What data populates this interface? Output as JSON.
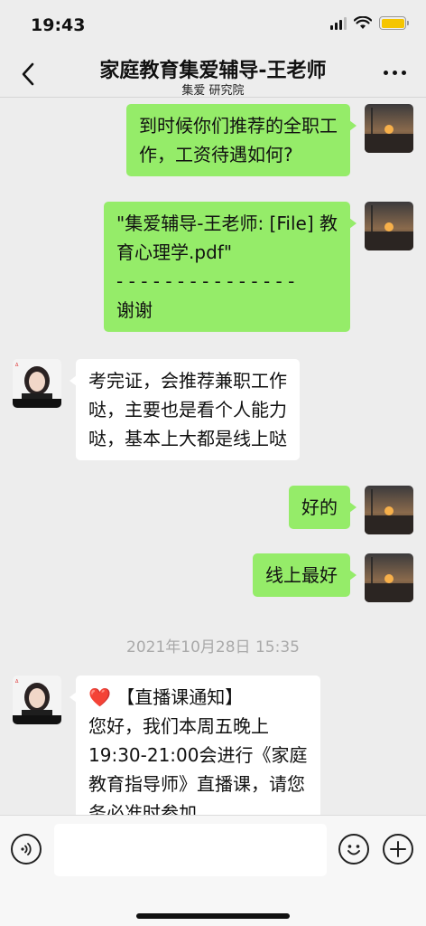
{
  "status_bar": {
    "time": "19:43",
    "battery_color": "#f5c500"
  },
  "nav": {
    "title": "家庭教育集爱辅导-王老师",
    "subtitle": "集爱 研究院",
    "back_icon": "chevron-left-icon",
    "more_icon": "more-dots-icon"
  },
  "messages": [
    {
      "sender": "me",
      "lines": [
        "到时候你们推荐的全职工",
        "作，工资待遇如何?"
      ]
    },
    {
      "sender": "me",
      "lines": [
        "\"集爱辅导-王老师: [File] 教",
        "育心理学.pdf\"",
        "- - - - - - - - - - - - - - -",
        "谢谢"
      ]
    },
    {
      "sender": "other",
      "lines": [
        "考完证，会推荐兼职工作",
        "哒，主要也是看个人能力",
        "哒，基本上大都是线上哒"
      ]
    },
    {
      "sender": "me",
      "lines": [
        "好的"
      ]
    },
    {
      "sender": "me",
      "lines": [
        "线上最好"
      ]
    },
    {
      "sender": "other",
      "lines": [
        "❤️ 【直播课通知】",
        "您好，我们本周五晚上",
        "19:30-21:00会进行《家庭",
        "教育指导师》直播课，请您",
        "务必准时参加"
      ]
    }
  ],
  "timestamp": "2021年10月28日 15:35",
  "input_bar": {
    "voice_icon": "voice-icon",
    "emoji_icon": "emoji-icon",
    "plus_icon": "plus-icon",
    "input_value": ""
  },
  "colors": {
    "background": "#ededed",
    "my_bubble": "#95ec69",
    "other_bubble": "#ffffff"
  }
}
